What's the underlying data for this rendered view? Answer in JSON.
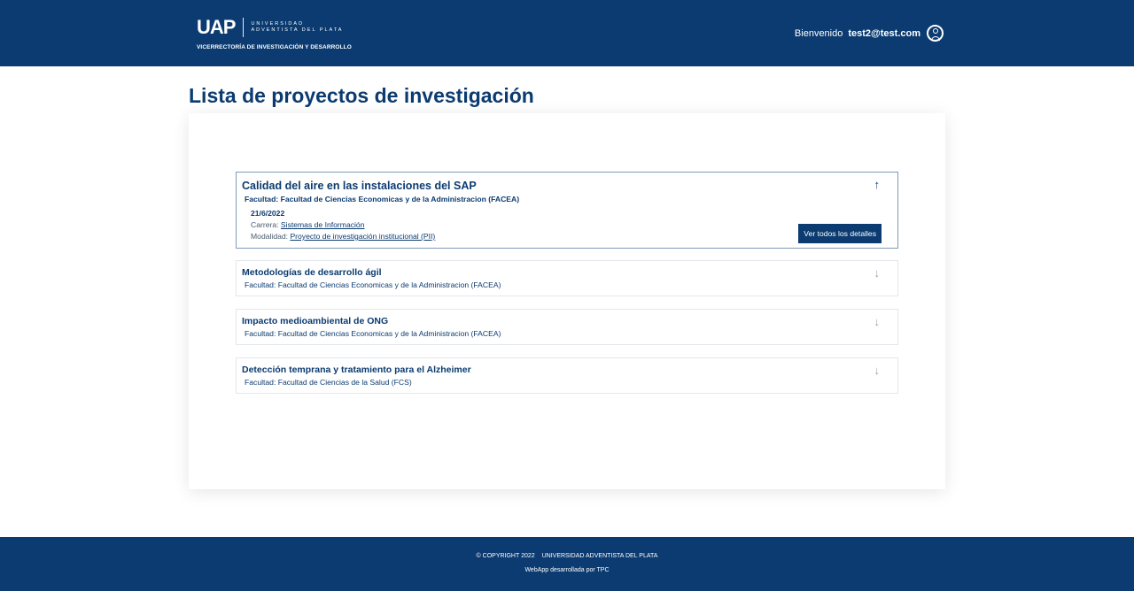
{
  "header": {
    "logo_mark": "UAP",
    "logo_words_1": "UNIVERSIDAD",
    "logo_words_2": "ADVENTISTA DEL PLATA",
    "logo_subtitle": "VICERRECTORÍA DE INVESTIGACIÓN Y DESARROLLO",
    "welcome": "Bienvenido",
    "user_email": "test2@test.com",
    "user_icon": "user-circle-icon"
  },
  "page": {
    "title": "Lista de proyectos de investigación"
  },
  "projects": [
    {
      "title": "Calidad del aire en las instalaciones del SAP",
      "faculty": "Facultad: Facultad de Ciencias Economicas y de la Administracion (FACEA)",
      "expanded": true,
      "arrow": "↑",
      "date": "21/6/2022",
      "career_label": "Carrera:",
      "career_value": "Sistemas de Información",
      "modality_label": "Modalidad:",
      "modality_value": "Proyecto de investigación institucional (PII)",
      "details_button": "Ver todos los detalles"
    },
    {
      "title": "Metodologías de desarrollo ágil",
      "faculty": "Facultad: Facultad de Ciencias Economicas y de la Administracion (FACEA)",
      "expanded": false,
      "arrow": "↓"
    },
    {
      "title": "Impacto medioambiental de ONG",
      "faculty": "Facultad: Facultad de Ciencias Economicas y de la Administracion (FACEA)",
      "expanded": false,
      "arrow": "↓"
    },
    {
      "title": "Detección temprana y tratamiento para el Alzheimer",
      "faculty": "Facultad: Facultad de Ciencias de la Salud (FCS)",
      "expanded": false,
      "arrow": "↓"
    }
  ],
  "footer": {
    "copyright": "© COPYRIGHT 2022",
    "university": "UNIVERSIDAD ADVENTISTA DEL PLATA",
    "credit": "WebApp desarrollada por TPC"
  },
  "colors": {
    "brand": "#0b3b70",
    "expanded_border": "#7e9bb8",
    "muted_arrow": "#9aa3ad"
  }
}
